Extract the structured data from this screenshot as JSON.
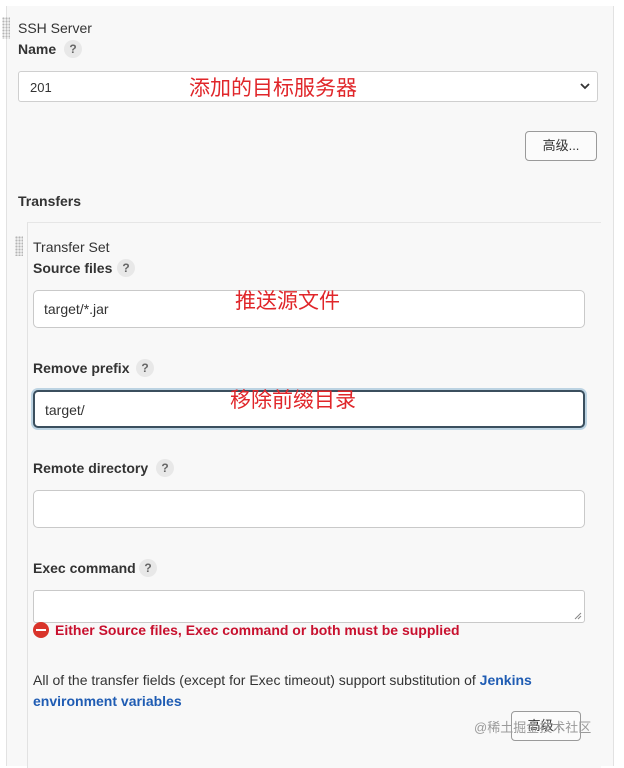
{
  "ssh_server": {
    "section_title": "SSH Server",
    "name_label": "Name",
    "help_glyph": "?",
    "selected_server": "201",
    "annotation": "添加的目标服务器",
    "advanced_button": "高级..."
  },
  "transfers": {
    "title": "Transfers",
    "transfer_set_title": "Transfer Set",
    "source_files": {
      "label": "Source files",
      "value": "target/*.jar",
      "annotation": "推送源文件"
    },
    "remove_prefix": {
      "label": "Remove prefix",
      "value": "target/",
      "annotation": "移除前缀目录"
    },
    "remote_directory": {
      "label": "Remote directory",
      "value": ""
    },
    "exec_command": {
      "label": "Exec command",
      "value": ""
    },
    "error_message": "Either Source files, Exec command or both must be supplied",
    "description_text": "All of the transfer fields (except for Exec timeout) support substitution of ",
    "description_link": "Jenkins environment variables",
    "advanced_button": "高级..."
  },
  "watermark": "@稀土掘金技术社区",
  "colors": {
    "annotation_red": "#e0262a",
    "error_red": "#c8102e",
    "link_blue": "#1f5cb3",
    "panel_bg": "#f8f8f8",
    "active_field_border": "#3b4f5e"
  }
}
